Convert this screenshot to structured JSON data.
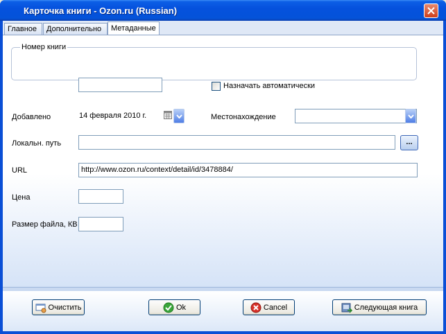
{
  "window": {
    "title": "Карточка книги - Ozon.ru (Russian)"
  },
  "tabs": [
    {
      "label": "Главное",
      "active": false
    },
    {
      "label": "Дополнительно",
      "active": false
    },
    {
      "label": "Метаданные",
      "active": true
    }
  ],
  "book_number": {
    "legend": "Номер книги",
    "value": "",
    "auto_assign_label": "Назначать автоматически",
    "auto_assign_checked": false
  },
  "added": {
    "label": "Добавлено",
    "value": "14  февраля  2010 г."
  },
  "location": {
    "label": "Местонахождение",
    "value": ""
  },
  "local_path": {
    "label": "Локальн. путь",
    "value": "",
    "browse_label": "..."
  },
  "url": {
    "label": "URL",
    "value": "http://www.ozon.ru/context/detail/id/3478884/"
  },
  "price": {
    "label": "Цена",
    "value": ""
  },
  "file_size": {
    "label": "Размер файла, КВ",
    "value": ""
  },
  "buttons": {
    "clear": "Очистить",
    "ok": "Ok",
    "cancel": "Cancel",
    "next": "Следующая книга"
  },
  "icons": {
    "close": "close-icon",
    "calendar": "calendar-icon",
    "clear": "eraser-icon",
    "ok": "check-icon",
    "cancel": "cancel-icon",
    "next": "next-book-icon"
  },
  "colors": {
    "titlebar": "#0551dd",
    "close_button": "#cf3f1c",
    "panel_gradient_end": "#d5e3f7",
    "input_border": "#7f9db9"
  }
}
